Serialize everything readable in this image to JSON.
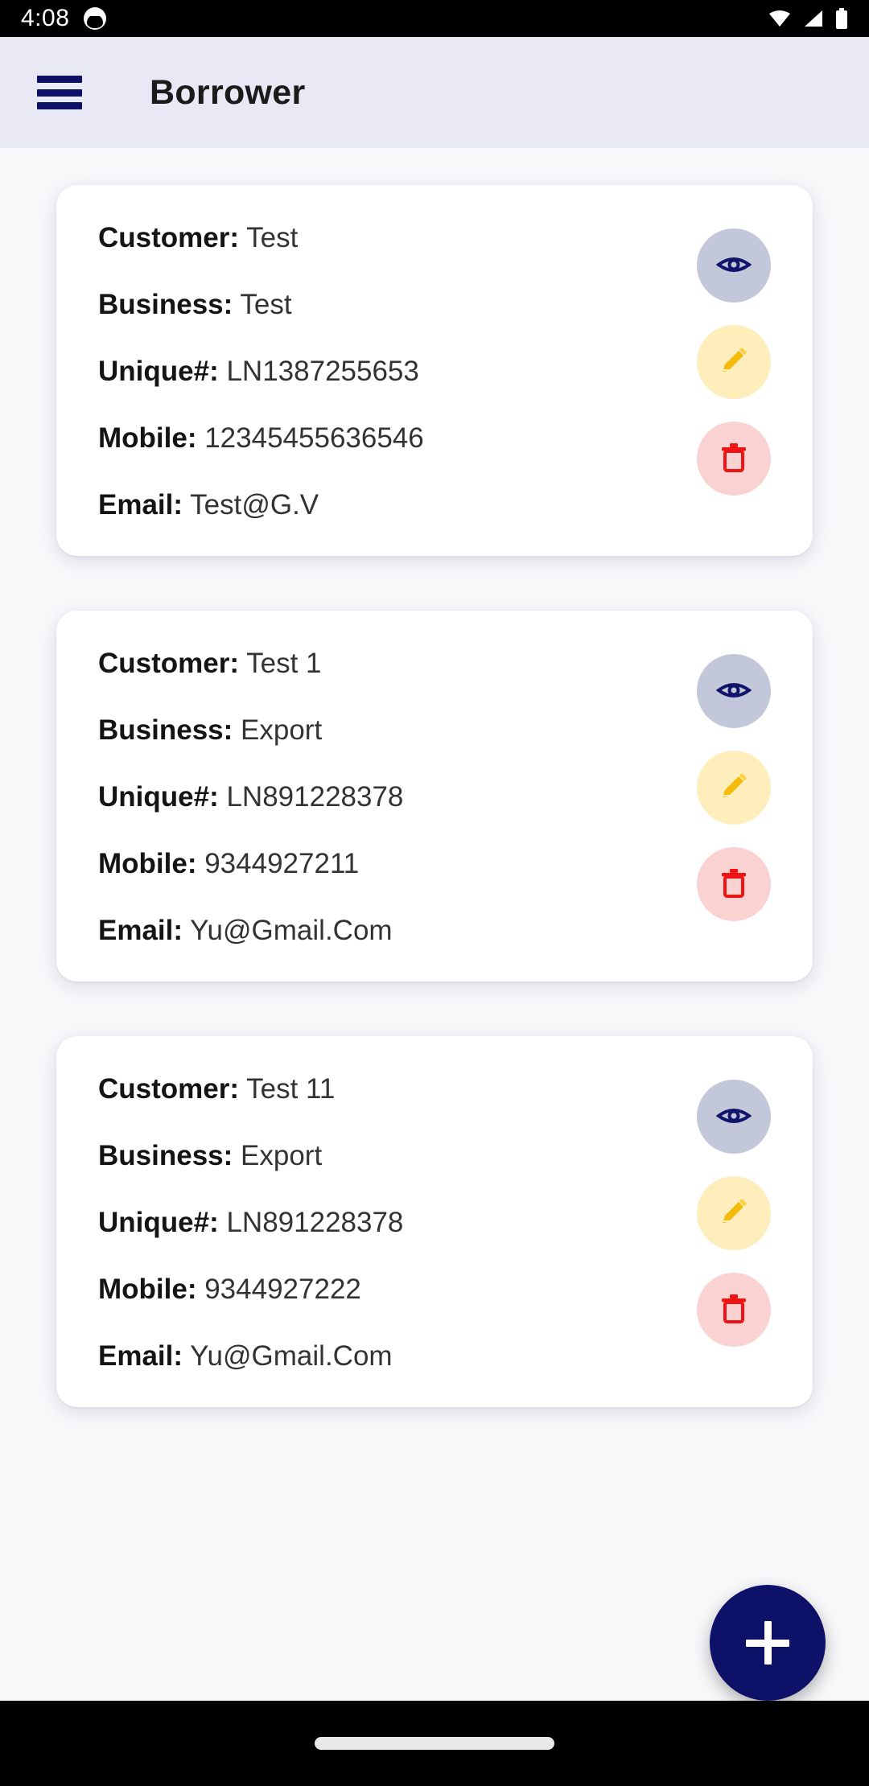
{
  "status_bar": {
    "time": "4:08",
    "app_icon": "cat-app-icon",
    "icons": [
      "wifi-icon",
      "cellular-signal-icon",
      "battery-icon"
    ]
  },
  "app_bar": {
    "menu_icon": "hamburger-menu-icon",
    "title": "Borrower",
    "background_color": "#e9e9f6",
    "icon_color": "#0e1065"
  },
  "labels": {
    "customer": "Customer:",
    "business": "Business:",
    "unique": "Unique#:",
    "mobile": "Mobile:",
    "email": "Email:"
  },
  "actions": {
    "view": {
      "name": "view-button",
      "icon": "eye-icon",
      "bg": "#c3c7da",
      "fg": "#11146b"
    },
    "edit": {
      "name": "edit-button",
      "icon": "pencil-icon",
      "bg": "#fdeebb",
      "fg": "#f6ba0a"
    },
    "delete": {
      "name": "delete-button",
      "icon": "trash-icon",
      "bg": "#fbd2d2",
      "fg": "#ee1414"
    }
  },
  "borrowers": [
    {
      "customer": "Test",
      "business": "Test",
      "unique": "LN1387255653",
      "mobile": "12345455636546",
      "email": "Test@G.V"
    },
    {
      "customer": "Test 1",
      "business": "Export",
      "unique": "LN891228378",
      "mobile": "9344927211",
      "email": "Yu@Gmail.Com"
    },
    {
      "customer": "Test 11",
      "business": "Export",
      "unique": "LN891228378",
      "mobile": "9344927222",
      "email": "Yu@Gmail.Com"
    }
  ],
  "fab": {
    "name": "add-borrower-fab",
    "icon": "plus-icon",
    "color": "#0d1167"
  },
  "nav_bar": {
    "gesture_pill": "home-gesture-pill"
  }
}
